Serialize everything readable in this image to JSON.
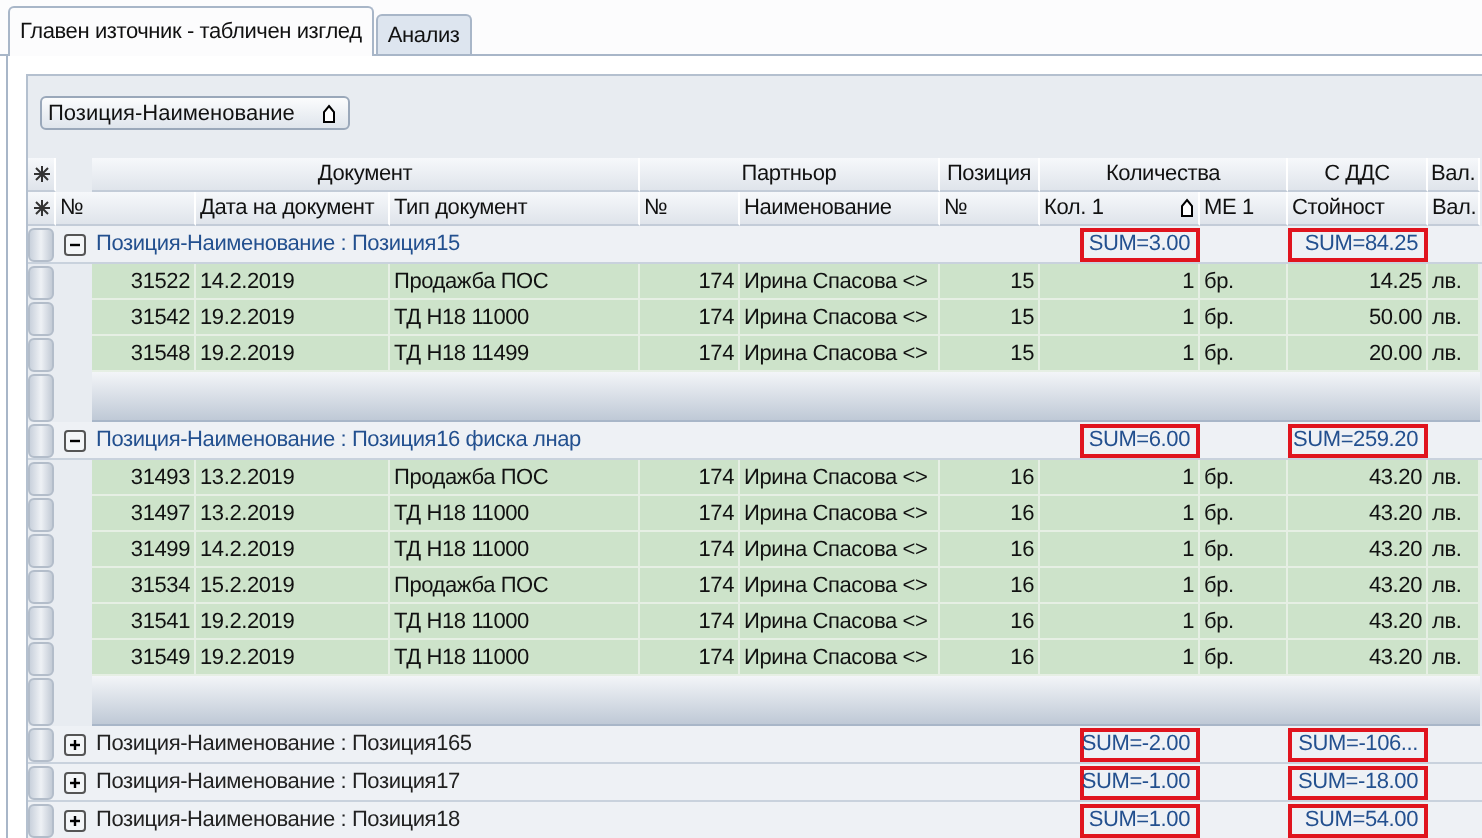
{
  "tabs": [
    {
      "label": "Главен източник - табличен изглед",
      "selected": true
    },
    {
      "label": "Анализ",
      "selected": false
    }
  ],
  "group_by": {
    "label": "Позиция-Наименование"
  },
  "bands": [
    {
      "label": "Документ",
      "columns": [
        {
          "label": "№",
          "kind": "number",
          "sorted": false
        },
        {
          "label": "Дата на документ",
          "kind": "text",
          "sorted": false
        },
        {
          "label": "Тип документ",
          "kind": "text",
          "sorted": false
        }
      ]
    },
    {
      "label": "Партньор",
      "columns": [
        {
          "label": "№",
          "kind": "number",
          "sorted": false
        },
        {
          "label": "Наименование",
          "kind": "text",
          "sorted": false
        }
      ]
    },
    {
      "label": "Позиция",
      "columns": [
        {
          "label": "№",
          "kind": "number",
          "sorted": false
        }
      ]
    },
    {
      "label": "Количества",
      "columns": [
        {
          "label": "Кол. 1",
          "kind": "number",
          "sorted": true
        },
        {
          "label": "МЕ 1",
          "kind": "text",
          "sorted": false
        }
      ]
    },
    {
      "label": "С ДДС",
      "columns": [
        {
          "label": "Стойност",
          "kind": "number",
          "sorted": false
        }
      ]
    },
    {
      "label": "Вал.",
      "columns": [
        {
          "label": "Вал.",
          "kind": "text",
          "sorted": false
        }
      ]
    }
  ],
  "groups": [
    {
      "label": "Позиция-Наименование : Позиция15",
      "expanded": true,
      "sum_quantity": "SUM=3.00",
      "sum_value": "SUM=84.25",
      "rows": [
        [
          "31522",
          "14.2.2019",
          "Продажба ПОС",
          "174",
          "Ирина Спасова <>",
          "15",
          "1",
          "бр.",
          "14.25",
          "лв."
        ],
        [
          "31542",
          "19.2.2019",
          "ТД Н18 11000",
          "174",
          "Ирина Спасова <>",
          "15",
          "1",
          "бр.",
          "50.00",
          "лв."
        ],
        [
          "31548",
          "19.2.2019",
          "ТД Н18 11499",
          "174",
          "Ирина Спасова <>",
          "15",
          "1",
          "бр.",
          "20.00",
          "лв."
        ]
      ]
    },
    {
      "label": "Позиция-Наименование : Позиция16 фиска лнар",
      "expanded": true,
      "sum_quantity": "SUM=6.00",
      "sum_value": "SUM=259.20",
      "rows": [
        [
          "31493",
          "13.2.2019",
          "Продажба ПОС",
          "174",
          "Ирина Спасова <>",
          "16",
          "1",
          "бр.",
          "43.20",
          "лв."
        ],
        [
          "31497",
          "13.2.2019",
          "ТД Н18 11000",
          "174",
          "Ирина Спасова <>",
          "16",
          "1",
          "бр.",
          "43.20",
          "лв."
        ],
        [
          "31499",
          "14.2.2019",
          "ТД Н18 11000",
          "174",
          "Ирина Спасова <>",
          "16",
          "1",
          "бр.",
          "43.20",
          "лв."
        ],
        [
          "31534",
          "15.2.2019",
          "Продажба ПОС",
          "174",
          "Ирина Спасова <>",
          "16",
          "1",
          "бр.",
          "43.20",
          "лв."
        ],
        [
          "31541",
          "19.2.2019",
          "ТД Н18 11000",
          "174",
          "Ирина Спасова <>",
          "16",
          "1",
          "бр.",
          "43.20",
          "лв."
        ],
        [
          "31549",
          "19.2.2019",
          "ТД Н18 11000",
          "174",
          "Ирина Спасова <>",
          "16",
          "1",
          "бр.",
          "43.20",
          "лв."
        ]
      ]
    },
    {
      "label": "Позиция-Наименование : Позиция165",
      "expanded": false,
      "sum_quantity": "SUM=-2.00",
      "sum_value": "SUM=-106..."
    },
    {
      "label": "Позиция-Наименование : Позиция17",
      "expanded": false,
      "sum_quantity": "SUM=-1.00",
      "sum_value": "SUM=-18.00"
    },
    {
      "label": "Позиция-Наименование : Позиция18",
      "expanded": false,
      "sum_quantity": "SUM=1.00",
      "sum_value": "SUM=54.00"
    }
  ]
}
